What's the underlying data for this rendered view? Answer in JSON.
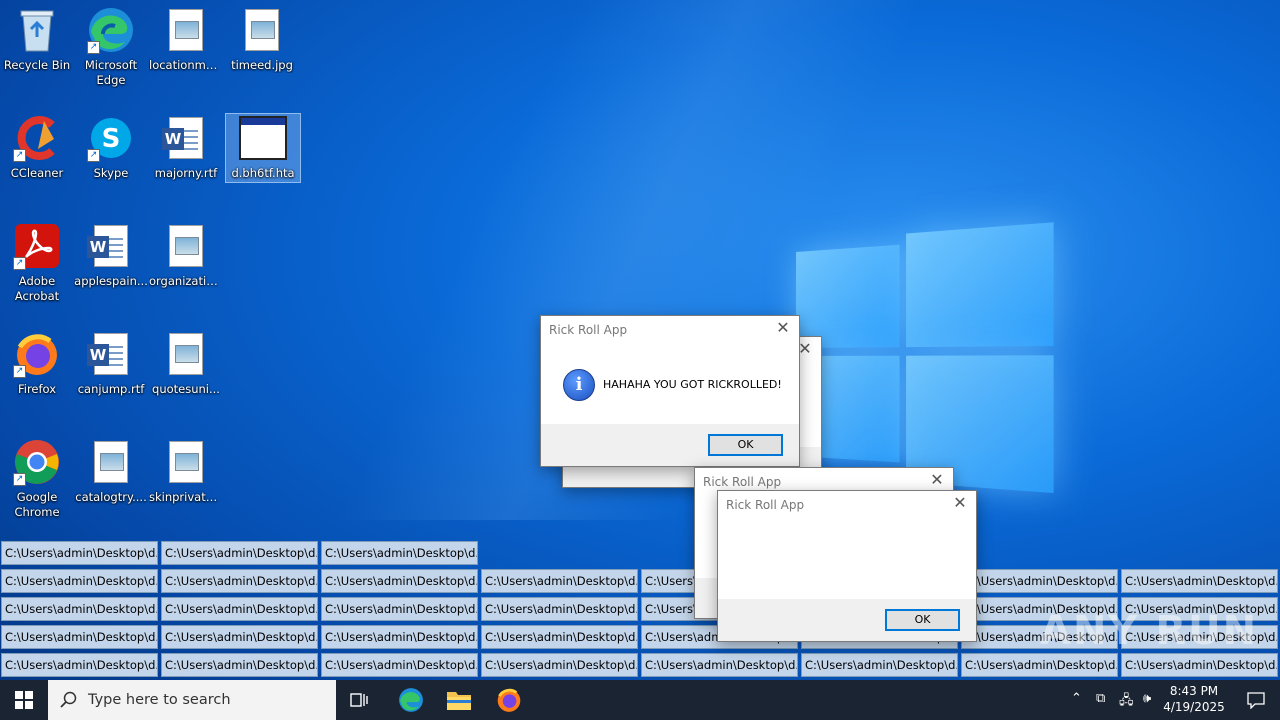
{
  "desktop": {
    "icons": [
      {
        "label": "Recycle Bin"
      },
      {
        "label": "Microsoft Edge"
      },
      {
        "label": "locationma..."
      },
      {
        "label": "timeed.jpg"
      },
      {
        "label": "CCleaner"
      },
      {
        "label": "Skype"
      },
      {
        "label": "majorny.rtf"
      },
      {
        "label": "d.bh6tf.hta"
      },
      {
        "label": "Adobe Acrobat"
      },
      {
        "label": "applespain..."
      },
      {
        "label": "organizatio..."
      },
      {
        "label": "Firefox"
      },
      {
        "label": "canjump.rtf"
      },
      {
        "label": "quotesuni..."
      },
      {
        "label": "Google Chrome"
      },
      {
        "label": "catalogtry...."
      },
      {
        "label": "skinprivate...."
      }
    ],
    "minimized_bar_text": "C:\\Users\\admin\\Desktop\\d..."
  },
  "dialogs": {
    "main": {
      "title": "Rick Roll App",
      "message": "HAHAHA YOU GOT RICKROLLED!",
      "ok_label": "OK"
    },
    "back": {
      "title": "Rick Roll App",
      "ok_label": "OK"
    },
    "middle": {
      "title": "Rick Roll App"
    },
    "front": {
      "title": "Rick Roll App",
      "ok_label": "OK"
    }
  },
  "taskbar": {
    "search_placeholder": "Type here to search",
    "time": "8:43 PM",
    "date": "4/19/2025"
  },
  "watermark": "ANY RUN",
  "colors": {
    "accent": "#0078d7",
    "taskbar": "#1b2433",
    "minimized_bar": "#c3d5ea"
  }
}
